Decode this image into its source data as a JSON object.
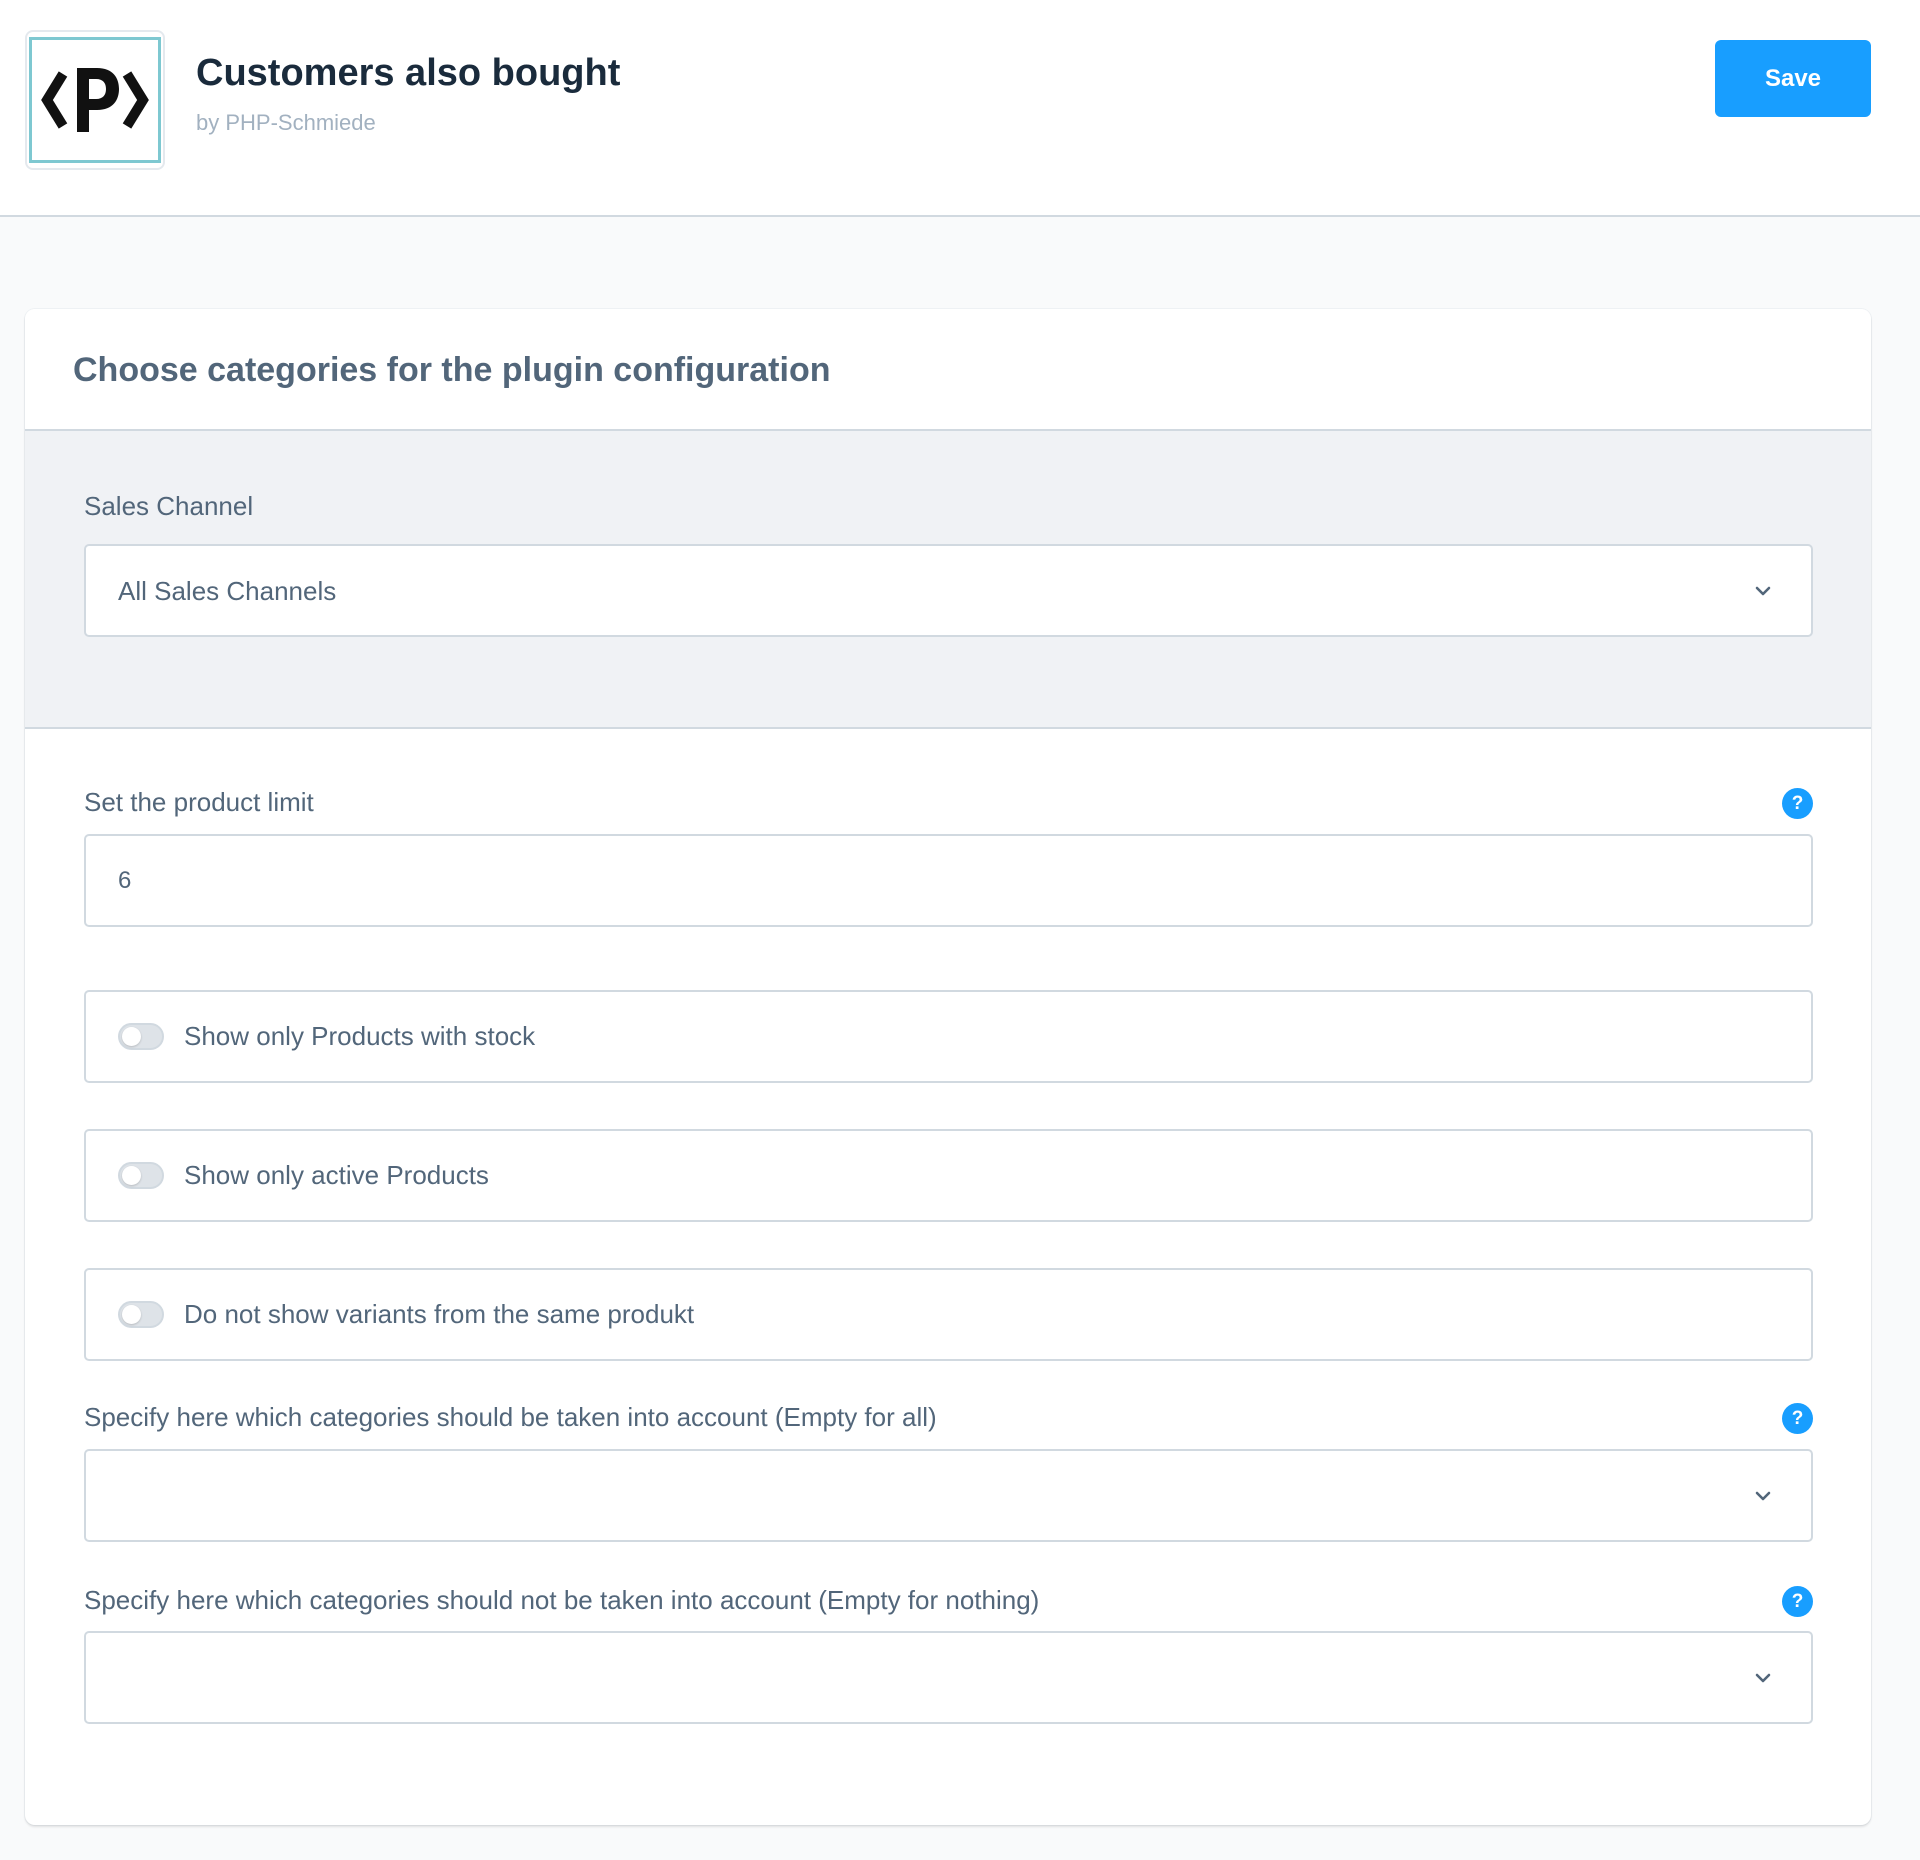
{
  "header": {
    "logo_text": "<P>",
    "title": "Customers also bought",
    "subtitle": "by PHP-Schmiede",
    "save_label": "Save"
  },
  "card": {
    "title": "Choose categories for the plugin configuration",
    "sales_channel": {
      "label": "Sales Channel",
      "selected": "All Sales Channels"
    },
    "product_limit": {
      "label": "Set the product limit",
      "value": "6"
    },
    "toggles": [
      {
        "label": "Show only Products with stock",
        "checked": false
      },
      {
        "label": "Show only active Products",
        "checked": false
      },
      {
        "label": "Do not show variants from the same produkt",
        "checked": false
      }
    ],
    "include_categories": {
      "label": "Specify here which categories should be taken into account (Empty for all)",
      "selected": ""
    },
    "exclude_categories": {
      "label": "Specify here which categories should not be taken into account (Empty for nothing)",
      "selected": ""
    }
  },
  "icons": {
    "help": "?",
    "dropdown": "chevron-down-icon"
  },
  "colors": {
    "primary": "#189eff",
    "text": "#52667a",
    "heading": "#1a2b3c",
    "border": "#d1d9e0",
    "panel": "#f0f2f5",
    "logo_frame": "#7ec8d1"
  }
}
